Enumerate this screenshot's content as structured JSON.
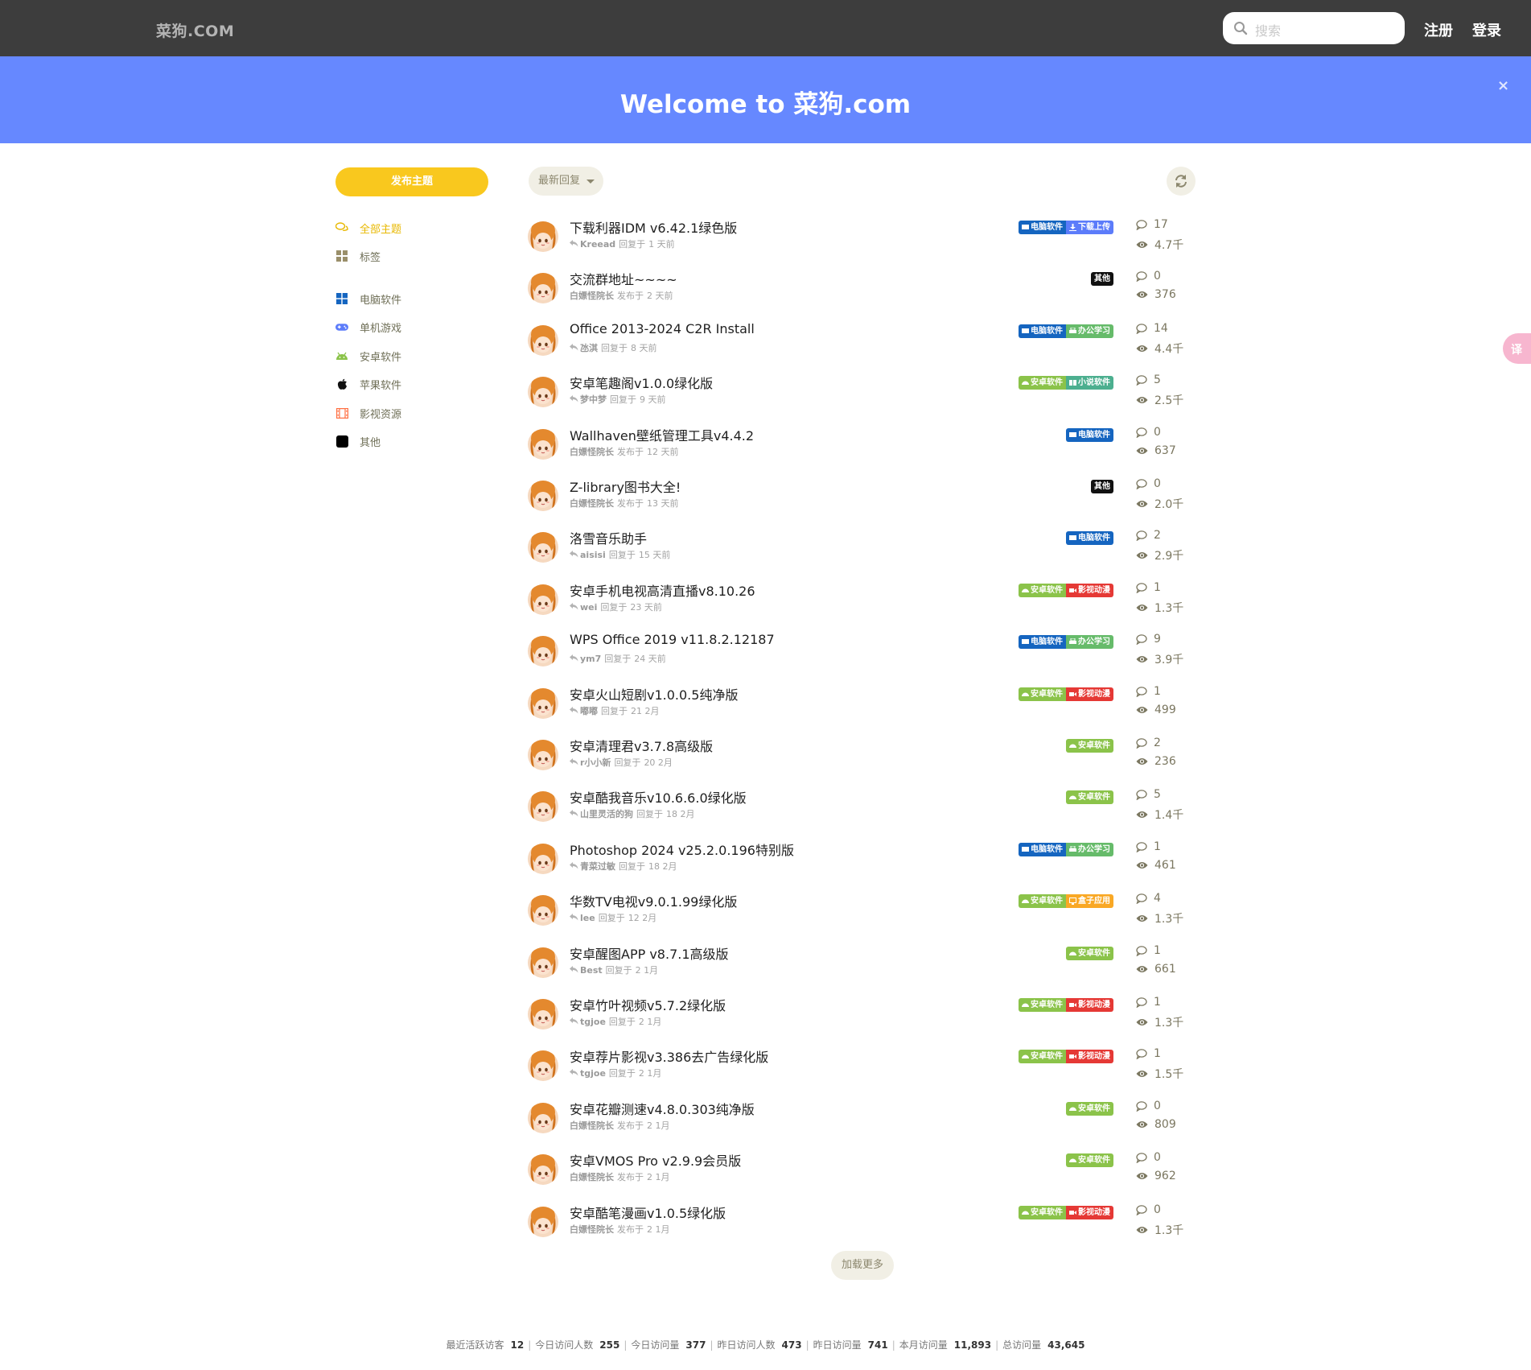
{
  "header": {
    "logo": "菜狗.COM",
    "search_placeholder": "搜索",
    "register": "注册",
    "login": "登录"
  },
  "hero": {
    "title": "Welcome to 菜狗.com",
    "close": "×"
  },
  "sidebar": {
    "new_topic": "发布主题",
    "items": [
      {
        "label": "全部主题",
        "icon": "comments-icon",
        "active": true
      },
      {
        "label": "标签",
        "icon": "tags-grid-icon",
        "active": false
      },
      {
        "label": "电脑软件",
        "icon": "windows-icon",
        "active": false
      },
      {
        "label": "单机游戏",
        "icon": "gamepad-icon",
        "active": false
      },
      {
        "label": "安卓软件",
        "icon": "android-icon",
        "active": false
      },
      {
        "label": "苹果软件",
        "icon": "apple-icon",
        "active": false
      },
      {
        "label": "影视资源",
        "icon": "film-icon",
        "active": false
      },
      {
        "label": "其他",
        "icon": "square-icon",
        "active": false
      }
    ]
  },
  "list": {
    "sort_label": "最新回复",
    "load_more": "加载更多",
    "colors": {
      "pc": "#1565c0",
      "download": "#5c7cfa",
      "other": "#111111",
      "office": "#66bb6a",
      "android": "#8bc34a",
      "novel": "#4caf8f",
      "video": "#e53935",
      "box": "#f9a825"
    },
    "rows": [
      {
        "title": "下载利器IDM v6.42.1绿色版",
        "user": "Kreead",
        "action": "回复于",
        "time": "1 天前",
        "replied": true,
        "comments": "17",
        "views": "4.7千",
        "tags": [
          {
            "label": "电脑软件",
            "kind": "pc"
          },
          {
            "label": "下载上传",
            "kind": "download"
          }
        ]
      },
      {
        "title": "交流群地址~~~~",
        "user": "白嫖怪院长",
        "action": "发布于",
        "time": "2 天前",
        "replied": false,
        "comments": "0",
        "views": "376",
        "tags": [
          {
            "label": "其他",
            "kind": "other"
          }
        ]
      },
      {
        "title": "Office 2013-2024 C2R Install",
        "user": "氹淇",
        "action": "回复于",
        "time": "8 天前",
        "replied": true,
        "comments": "14",
        "views": "4.4千",
        "tags": [
          {
            "label": "电脑软件",
            "kind": "pc"
          },
          {
            "label": "办公学习",
            "kind": "office"
          }
        ]
      },
      {
        "title": "安卓笔趣阁v1.0.0绿化版",
        "user": "梦中梦",
        "action": "回复于",
        "time": "9 天前",
        "replied": true,
        "comments": "5",
        "views": "2.5千",
        "tags": [
          {
            "label": "安卓软件",
            "kind": "android"
          },
          {
            "label": "小说软件",
            "kind": "novel"
          }
        ]
      },
      {
        "title": "Wallhaven壁纸管理工具v4.4.2",
        "user": "白嫖怪院长",
        "action": "发布于",
        "time": "12 天前",
        "replied": false,
        "comments": "0",
        "views": "637",
        "tags": [
          {
            "label": "电脑软件",
            "kind": "pc"
          }
        ]
      },
      {
        "title": "Z-library图书大全!",
        "user": "白嫖怪院长",
        "action": "发布于",
        "time": "13 天前",
        "replied": false,
        "comments": "0",
        "views": "2.0千",
        "tags": [
          {
            "label": "其他",
            "kind": "other"
          }
        ]
      },
      {
        "title": "洛雪音乐助手",
        "user": "aisisi",
        "action": "回复于",
        "time": "15 天前",
        "replied": true,
        "comments": "2",
        "views": "2.9千",
        "tags": [
          {
            "label": "电脑软件",
            "kind": "pc"
          }
        ]
      },
      {
        "title": "安卓手机电视高清直播v8.10.26",
        "user": "wei",
        "action": "回复于",
        "time": "23 天前",
        "replied": true,
        "comments": "1",
        "views": "1.3千",
        "tags": [
          {
            "label": "安卓软件",
            "kind": "android"
          },
          {
            "label": "影视动漫",
            "kind": "video"
          }
        ]
      },
      {
        "title": "WPS Office 2019 v11.8.2.12187",
        "user": "ym7",
        "action": "回复于",
        "time": "24 天前",
        "replied": true,
        "comments": "9",
        "views": "3.9千",
        "tags": [
          {
            "label": "电脑软件",
            "kind": "pc"
          },
          {
            "label": "办公学习",
            "kind": "office"
          }
        ]
      },
      {
        "title": "安卓火山短剧v1.0.0.5纯净版",
        "user": "嘟嘟",
        "action": "回复于",
        "time": "21 2月",
        "replied": true,
        "comments": "1",
        "views": "499",
        "tags": [
          {
            "label": "安卓软件",
            "kind": "android"
          },
          {
            "label": "影视动漫",
            "kind": "video"
          }
        ]
      },
      {
        "title": "安卓清理君v3.7.8高级版",
        "user": "r小小新",
        "action": "回复于",
        "time": "20 2月",
        "replied": true,
        "comments": "2",
        "views": "236",
        "tags": [
          {
            "label": "安卓软件",
            "kind": "android"
          }
        ]
      },
      {
        "title": "安卓酷我音乐v10.6.6.0绿化版",
        "user": "山里灵活的狗",
        "action": "回复于",
        "time": "18 2月",
        "replied": true,
        "comments": "5",
        "views": "1.4千",
        "tags": [
          {
            "label": "安卓软件",
            "kind": "android"
          }
        ]
      },
      {
        "title": "Photoshop 2024 v25.2.0.196特别版",
        "user": "青菜过敏",
        "action": "回复于",
        "time": "18 2月",
        "replied": true,
        "comments": "1",
        "views": "461",
        "tags": [
          {
            "label": "电脑软件",
            "kind": "pc"
          },
          {
            "label": "办公学习",
            "kind": "office"
          }
        ]
      },
      {
        "title": "华数TV电视v9.0.1.99绿化版",
        "user": "lee",
        "action": "回复于",
        "time": "12 2月",
        "replied": true,
        "comments": "4",
        "views": "1.3千",
        "tags": [
          {
            "label": "安卓软件",
            "kind": "android"
          },
          {
            "label": "盒子应用",
            "kind": "box"
          }
        ]
      },
      {
        "title": "安卓醒图APP v8.7.1高级版",
        "user": "Best",
        "action": "回复于",
        "time": "2 1月",
        "replied": true,
        "comments": "1",
        "views": "661",
        "tags": [
          {
            "label": "安卓软件",
            "kind": "android"
          }
        ]
      },
      {
        "title": "安卓竹叶视频v5.7.2绿化版",
        "user": "tgjoe",
        "action": "回复于",
        "time": "2 1月",
        "replied": true,
        "comments": "1",
        "views": "1.3千",
        "tags": [
          {
            "label": "安卓软件",
            "kind": "android"
          },
          {
            "label": "影视动漫",
            "kind": "video"
          }
        ]
      },
      {
        "title": "安卓荐片影视v3.386去广告绿化版",
        "user": "tgjoe",
        "action": "回复于",
        "time": "2 1月",
        "replied": true,
        "comments": "1",
        "views": "1.5千",
        "tags": [
          {
            "label": "安卓软件",
            "kind": "android"
          },
          {
            "label": "影视动漫",
            "kind": "video"
          }
        ]
      },
      {
        "title": "安卓花瓣测速v4.8.0.303纯净版",
        "user": "白嫖怪院长",
        "action": "发布于",
        "time": "2 1月",
        "replied": false,
        "comments": "0",
        "views": "809",
        "tags": [
          {
            "label": "安卓软件",
            "kind": "android"
          }
        ]
      },
      {
        "title": "安卓VMOS Pro v2.9.9会员版",
        "user": "白嫖怪院长",
        "action": "发布于",
        "time": "2 1月",
        "replied": false,
        "comments": "0",
        "views": "962",
        "tags": [
          {
            "label": "安卓软件",
            "kind": "android"
          }
        ]
      },
      {
        "title": "安卓酷笔漫画v1.0.5绿化版",
        "user": "白嫖怪院长",
        "action": "发布于",
        "time": "2 1月",
        "replied": false,
        "comments": "0",
        "views": "1.3千",
        "tags": [
          {
            "label": "安卓软件",
            "kind": "android"
          },
          {
            "label": "影视动漫",
            "kind": "video"
          }
        ]
      }
    ]
  },
  "footer": {
    "stats": [
      {
        "label": "最近活跃访客",
        "value": "12"
      },
      {
        "label": "今日访问人数",
        "value": "255"
      },
      {
        "label": "今日访问量",
        "value": "377"
      },
      {
        "label": "昨日访问人数",
        "value": "473"
      },
      {
        "label": "昨日访问量",
        "value": "741"
      },
      {
        "label": "本月访问量",
        "value": "11,893"
      },
      {
        "label": "总访问量",
        "value": "43,645"
      }
    ]
  },
  "translate_widget": "译"
}
